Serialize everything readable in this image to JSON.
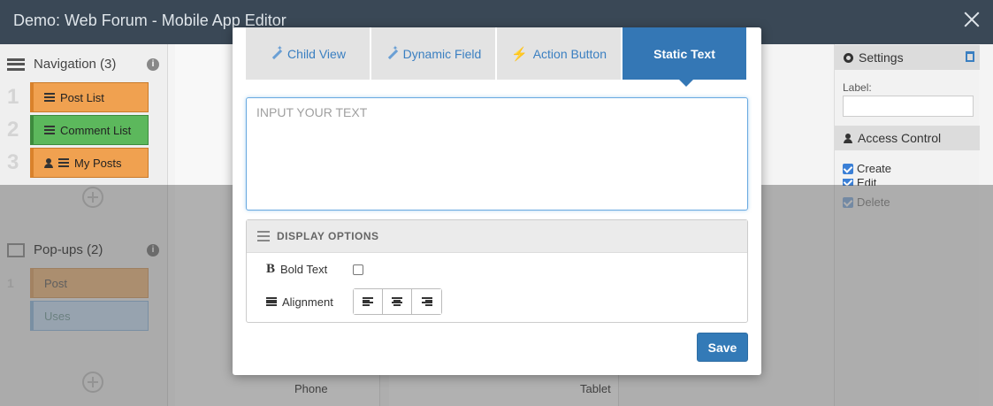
{
  "window": {
    "title": "Demo: Web Forum - Mobile App Editor"
  },
  "navigation": {
    "title": "Navigation (3)",
    "items": [
      {
        "num": "1",
        "label": "Post List",
        "color": "#f0a150"
      },
      {
        "num": "2",
        "label": "Comment List",
        "color": "#5cb85c"
      },
      {
        "num": "3",
        "label": "My Posts",
        "color": "#f0a150"
      }
    ]
  },
  "popups": {
    "title": "Pop-ups (2)",
    "items": [
      {
        "num": "1",
        "label": "Post"
      },
      {
        "num": "",
        "label": "Uses"
      }
    ]
  },
  "devices": {
    "phone": "Phone",
    "tablet": "Tablet"
  },
  "settings_panel": {
    "settings_title": "Settings",
    "label_text": "Label:",
    "access_title": "Access Control",
    "permissions": [
      {
        "label": "Create",
        "checked": true
      },
      {
        "label": "Edit",
        "checked": true
      },
      {
        "label": "Delete",
        "checked": true
      }
    ]
  },
  "modal": {
    "tabs": [
      {
        "label": "Child View",
        "icon": "wand-icon",
        "active": false
      },
      {
        "label": "Dynamic Field",
        "icon": "wand-icon",
        "active": false
      },
      {
        "label": "Action Button",
        "icon": "bolt-icon",
        "active": false
      },
      {
        "label": "Static Text",
        "icon": "",
        "active": true
      }
    ],
    "text_input": {
      "placeholder": "INPUT YOUR TEXT",
      "value": ""
    },
    "display_options": {
      "title": "DISPLAY OPTIONS",
      "bold_label": "Bold Text",
      "bold_checked": false,
      "alignment_label": "Alignment",
      "alignment_options": [
        "left",
        "center",
        "right"
      ]
    },
    "save_label": "Save"
  },
  "colors": {
    "accent": "#337ab7",
    "topbar": "#3a4856"
  }
}
